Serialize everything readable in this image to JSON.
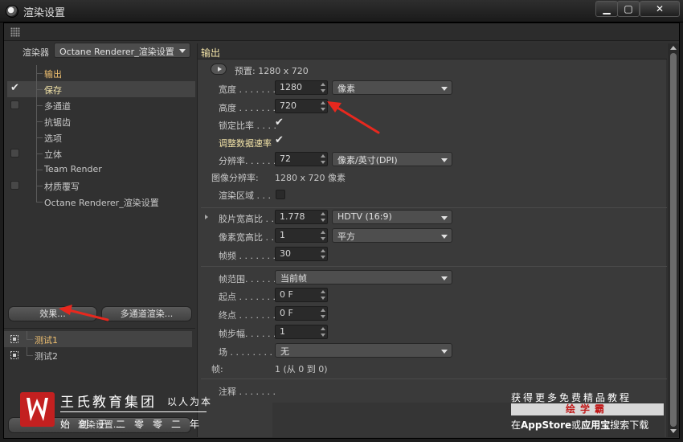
{
  "window": {
    "title": "渲染设置"
  },
  "left": {
    "renderer_label": "渲染器",
    "renderer_value": "Octane Renderer_渲染设置",
    "tree": [
      {
        "label": "输出",
        "checked": false,
        "has_checkbox": false,
        "active": true
      },
      {
        "label": "保存",
        "checked": true,
        "has_checkbox": true,
        "selected": true
      },
      {
        "label": "多通道",
        "checked": false,
        "has_checkbox": true
      },
      {
        "label": "抗锯齿",
        "checked": false,
        "has_checkbox": false
      },
      {
        "label": "选项",
        "checked": false,
        "has_checkbox": false
      },
      {
        "label": "立体",
        "checked": false,
        "has_checkbox": true
      },
      {
        "label": "Team Render",
        "checked": false,
        "has_checkbox": false
      },
      {
        "label": "材质覆写",
        "checked": false,
        "has_checkbox": true
      },
      {
        "label": "Octane Renderer_渲染设置",
        "checked": false,
        "has_checkbox": false
      }
    ],
    "effects_button": "效果...",
    "multipass_button": "多通道渲染...",
    "tests": [
      {
        "label": "测试1",
        "active": true
      },
      {
        "label": "测试2",
        "active": false
      }
    ],
    "render_settings_button": "渲染设置..."
  },
  "right": {
    "title": "输出",
    "preset_label": "预置: 1280 x 720",
    "width": {
      "label": "宽度 . . . . . . .",
      "value": "1280",
      "unit": "像素"
    },
    "height": {
      "label": "高度 . . . . . . .",
      "value": "720"
    },
    "lock_ratio": {
      "label": "锁定比率 . . . .",
      "checked": true
    },
    "adjust_rate": {
      "label": "调整数据速率",
      "checked": true
    },
    "resolution": {
      "label": "分辨率. . . . . .",
      "value": "72",
      "unit": "像素/英寸(DPI)"
    },
    "image_resolution": {
      "label": "图像分辨率:",
      "value": "1280 x 720 像素"
    },
    "render_region": {
      "label": "渲染区域 . . .",
      "checked": false
    },
    "film_aspect": {
      "label": "胶片宽高比 . .",
      "value": "1.778",
      "preset": "HDTV (16:9)"
    },
    "pixel_aspect": {
      "label": "像素宽高比 . .",
      "value": "1",
      "preset": "平方"
    },
    "fps": {
      "label": "帧频 . . . . . . .",
      "value": "30"
    },
    "frame_range": {
      "label": "帧范围. . . . . .",
      "value": "当前帧"
    },
    "start": {
      "label": "起点 . . . . . . .",
      "value": "0 F"
    },
    "end": {
      "label": "终点 . . . . . . .",
      "value": "0 F"
    },
    "frame_step": {
      "label": "帧步幅. . . . . .",
      "value": "1"
    },
    "field": {
      "label": "场 . . . . . . . . .",
      "value": "无"
    },
    "frames": {
      "label": "帧:",
      "value": "1 (从 0 到 0)"
    },
    "notes": {
      "label": "注释 . . . . . . ."
    }
  },
  "watermark": {
    "company": "王氏教育集团",
    "motto": "以人为本",
    "founded": "始创于二零零二年",
    "promo_line1": "获得更多免费精品教程",
    "promo_badge": "绘学霸",
    "promo_line2_a": "在",
    "promo_line2_b": "AppStore",
    "promo_line2_c": "或",
    "promo_line2_d": "应用宝",
    "promo_line2_e": "搜索下载"
  },
  "colors": {
    "highlight_label": "#f2e3a8",
    "active_label": "#f0c070",
    "arrow": "#e8281e",
    "logo_red": "#c32020"
  }
}
